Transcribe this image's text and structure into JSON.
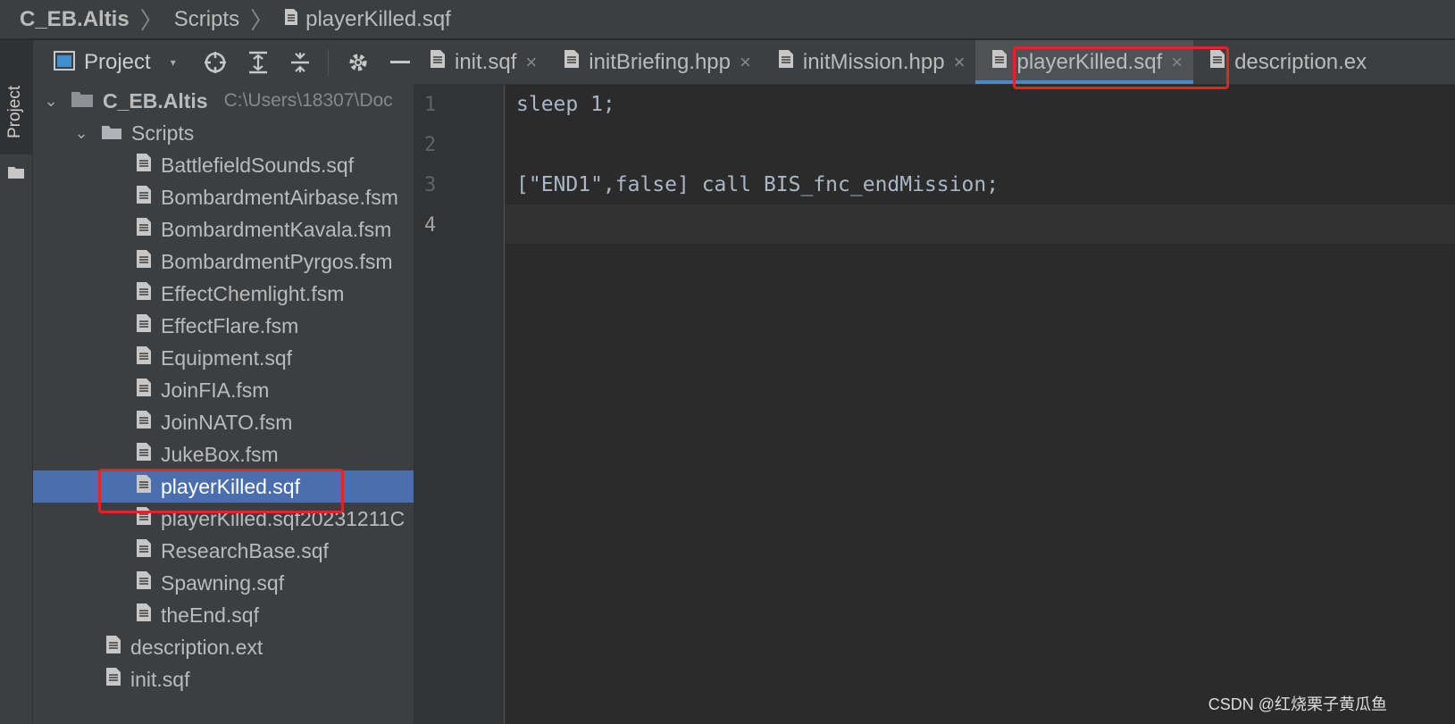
{
  "breadcrumb": {
    "items": [
      "C_EB.Altis",
      "Scripts",
      "playerKilled.sqf"
    ],
    "separator": "〉"
  },
  "toolstrip": {
    "project_label": "Project"
  },
  "project_panel": {
    "title": "Project",
    "root": {
      "name": "C_EB.Altis",
      "path": "C:\\Users\\18307\\Doc"
    },
    "scripts_folder": "Scripts",
    "script_files": [
      "BattlefieldSounds.sqf",
      "BombardmentAirbase.fsm",
      "BombardmentKavala.fsm",
      "BombardmentPyrgos.fsm",
      "EffectChemlight.fsm",
      "EffectFlare.fsm",
      "Equipment.sqf",
      "JoinFIA.fsm",
      "JoinNATO.fsm",
      "JukeBox.fsm",
      "playerKilled.sqf",
      "playerKilled.sqf20231211C",
      "ResearchBase.sqf",
      "Spawning.sqf",
      "theEnd.sqf"
    ],
    "selected_file": "playerKilled.sqf",
    "root_files": [
      "description.ext",
      "init.sqf"
    ]
  },
  "tabs": [
    {
      "label": "init.sqf",
      "active": false
    },
    {
      "label": "initBriefing.hpp",
      "active": false
    },
    {
      "label": "initMission.hpp",
      "active": false
    },
    {
      "label": "playerKilled.sqf",
      "active": true
    },
    {
      "label": "description.ex",
      "active": false
    }
  ],
  "editor": {
    "line_numbers": [
      "1",
      "2",
      "3",
      "4"
    ],
    "lines": [
      "sleep 1;",
      "",
      "[\"END1\",false] call BIS_fnc_endMission;",
      ""
    ],
    "current_line": 4
  },
  "watermark": "CSDN @红烧栗子黄瓜鱼",
  "colors": {
    "background": "#2b2b2b",
    "panel": "#3c3f41",
    "selection": "#4b6eaf",
    "highlight_box": "#e8231f",
    "code_text": "#a9b7c6"
  }
}
